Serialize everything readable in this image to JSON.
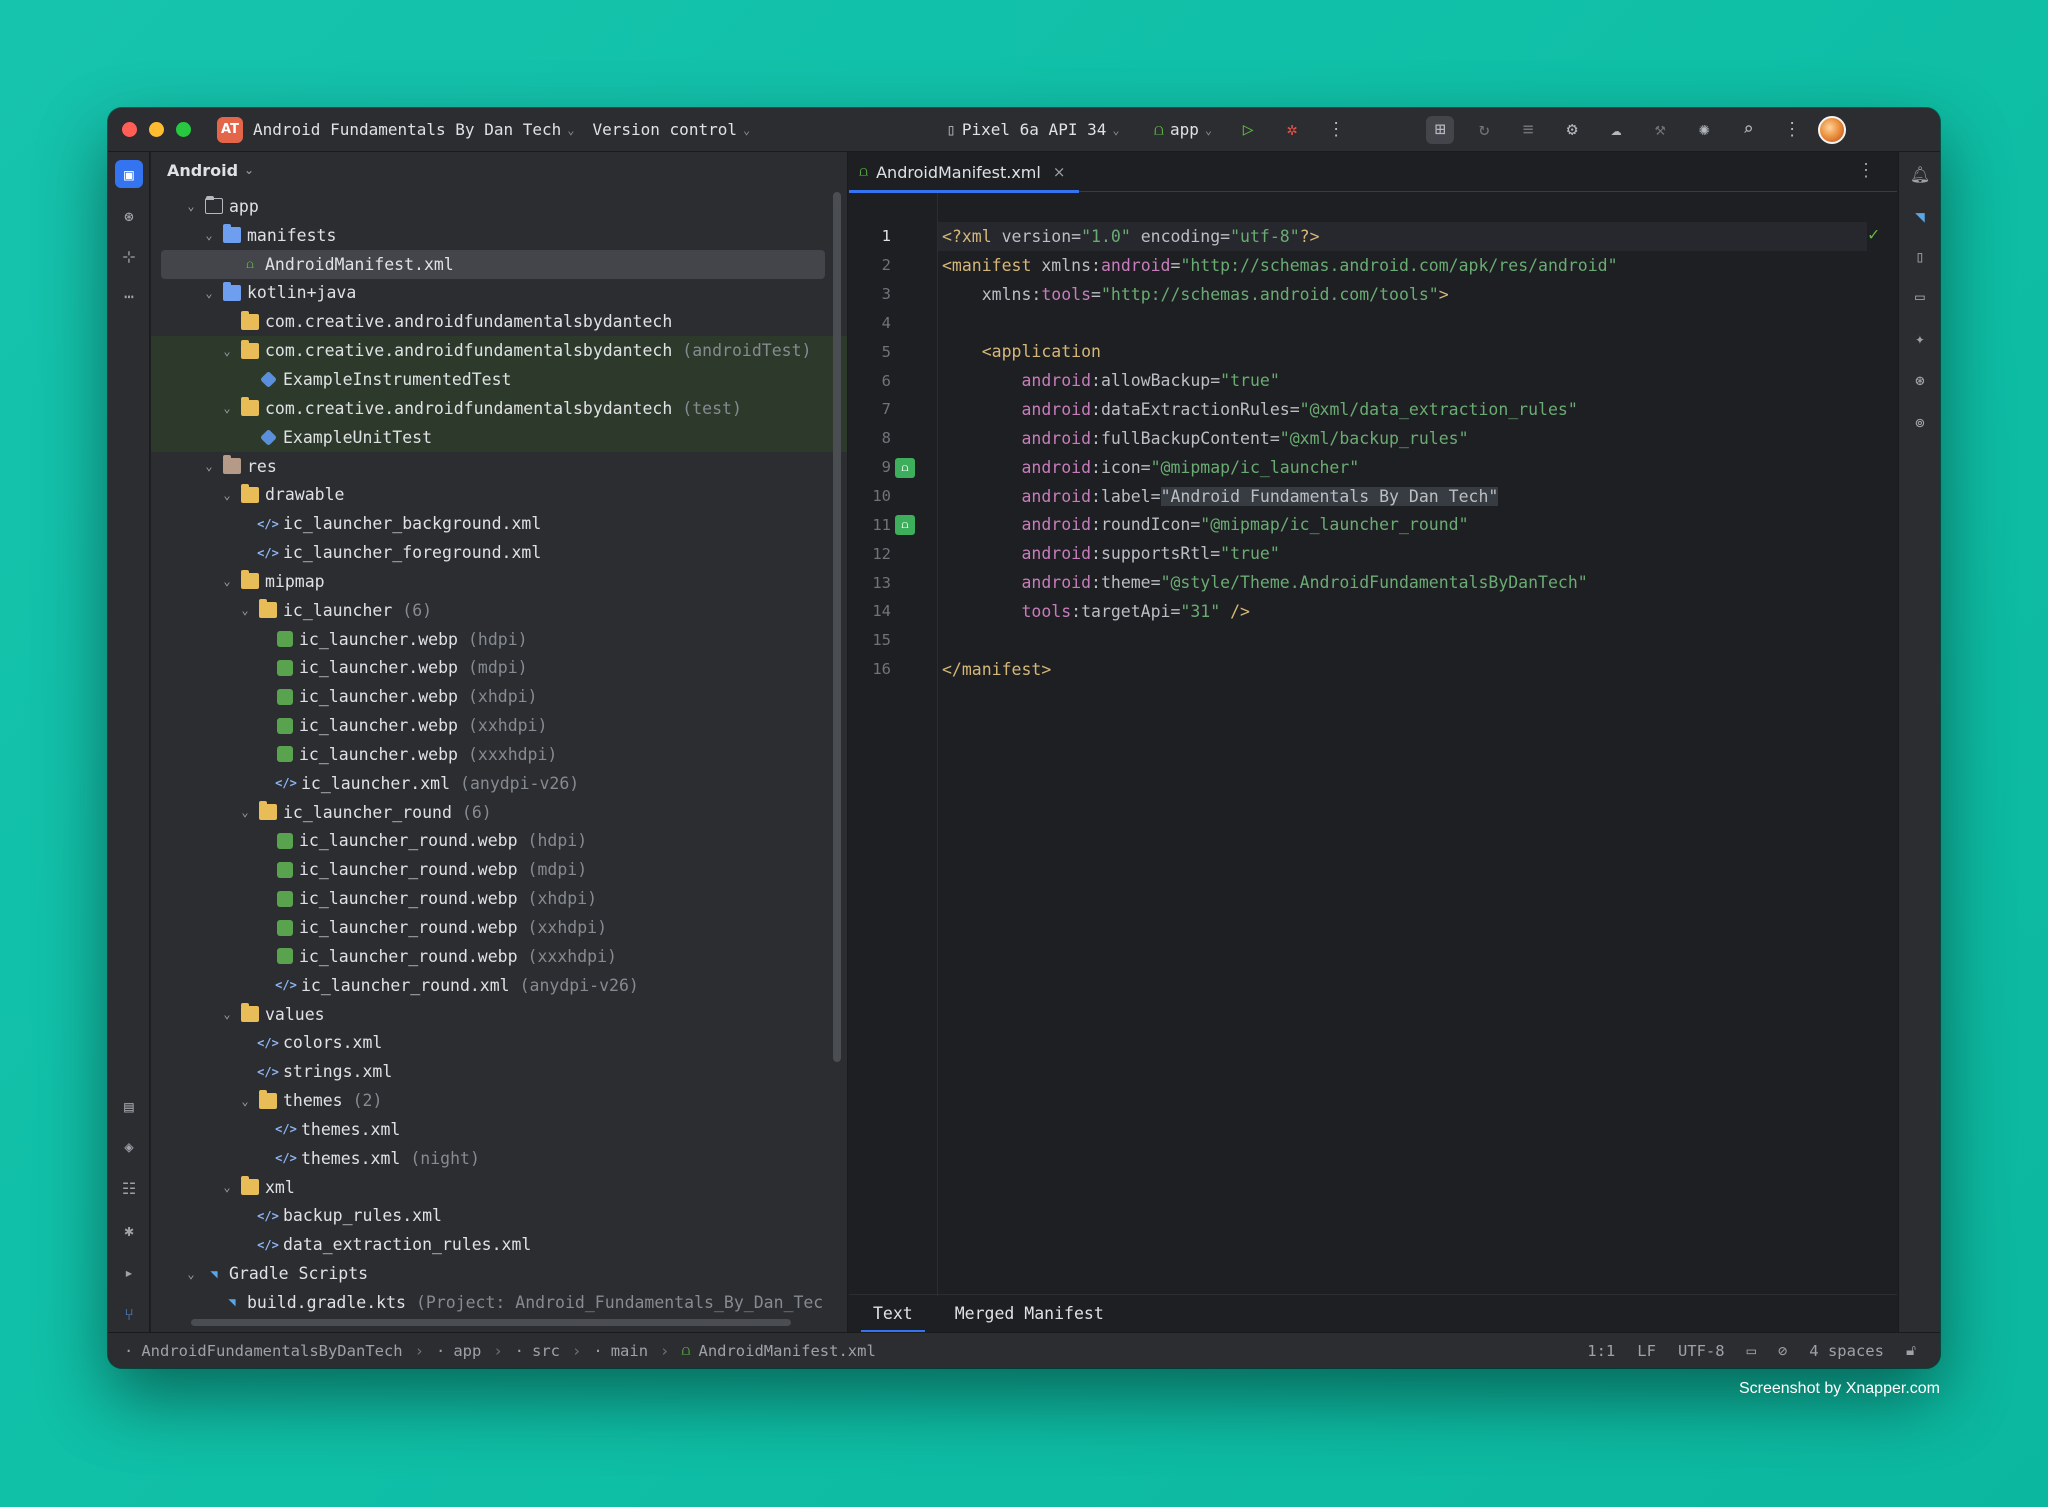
{
  "titlebar": {
    "project_initials": "AT",
    "project_name": "Android Fundamentals By Dan Tech",
    "vcs_label": "Version control",
    "device": "Pixel 6a API 34",
    "run_config": "app"
  },
  "project_panel": {
    "view_label": "Android",
    "tree": [
      {
        "depth": 0,
        "arrow": "v",
        "icon": "folder-outline",
        "label": "app"
      },
      {
        "depth": 1,
        "arrow": "v",
        "icon": "folder-blue",
        "label": "manifests"
      },
      {
        "depth": 2,
        "arrow": "",
        "icon": "android",
        "label": "AndroidManifest.xml",
        "selected": true
      },
      {
        "depth": 1,
        "arrow": "v",
        "icon": "folder-blue",
        "label": "kotlin+java"
      },
      {
        "depth": 2,
        "arrow": "",
        "icon": "folder",
        "label": "com.creative.androidfundamentalsbydantech"
      },
      {
        "depth": 2,
        "arrow": "v",
        "icon": "folder",
        "label": "com.creative.androidfundamentalsbydantech",
        "suffix": "(androidTest)",
        "test": true
      },
      {
        "depth": 3,
        "arrow": "",
        "icon": "class",
        "label": "ExampleInstrumentedTest",
        "test": true
      },
      {
        "depth": 2,
        "arrow": "v",
        "icon": "folder",
        "label": "com.creative.androidfundamentalsbydantech",
        "suffix": "(test)",
        "test": true
      },
      {
        "depth": 3,
        "arrow": "",
        "icon": "class",
        "label": "ExampleUnitTest",
        "test": true
      },
      {
        "depth": 1,
        "arrow": "v",
        "icon": "folder-res",
        "label": "res"
      },
      {
        "depth": 2,
        "arrow": "v",
        "icon": "folder",
        "label": "drawable"
      },
      {
        "depth": 3,
        "arrow": "",
        "icon": "xml",
        "label": "ic_launcher_background.xml"
      },
      {
        "depth": 3,
        "arrow": "",
        "icon": "xml",
        "label": "ic_launcher_foreground.xml"
      },
      {
        "depth": 2,
        "arrow": "v",
        "icon": "folder",
        "label": "mipmap"
      },
      {
        "depth": 3,
        "arrow": "v",
        "icon": "folder",
        "label": "ic_launcher",
        "suffix": "(6)"
      },
      {
        "depth": 4,
        "arrow": "",
        "icon": "webp",
        "label": "ic_launcher.webp",
        "suffix": "(hdpi)"
      },
      {
        "depth": 4,
        "arrow": "",
        "icon": "webp",
        "label": "ic_launcher.webp",
        "suffix": "(mdpi)"
      },
      {
        "depth": 4,
        "arrow": "",
        "icon": "webp",
        "label": "ic_launcher.webp",
        "suffix": "(xhdpi)"
      },
      {
        "depth": 4,
        "arrow": "",
        "icon": "webp",
        "label": "ic_launcher.webp",
        "suffix": "(xxhdpi)"
      },
      {
        "depth": 4,
        "arrow": "",
        "icon": "webp",
        "label": "ic_launcher.webp",
        "suffix": "(xxxhdpi)"
      },
      {
        "depth": 4,
        "arrow": "",
        "icon": "xml",
        "label": "ic_launcher.xml",
        "suffix": "(anydpi-v26)"
      },
      {
        "depth": 3,
        "arrow": "v",
        "icon": "folder",
        "label": "ic_launcher_round",
        "suffix": "(6)"
      },
      {
        "depth": 4,
        "arrow": "",
        "icon": "webp",
        "label": "ic_launcher_round.webp",
        "suffix": "(hdpi)"
      },
      {
        "depth": 4,
        "arrow": "",
        "icon": "webp",
        "label": "ic_launcher_round.webp",
        "suffix": "(mdpi)"
      },
      {
        "depth": 4,
        "arrow": "",
        "icon": "webp",
        "label": "ic_launcher_round.webp",
        "suffix": "(xhdpi)"
      },
      {
        "depth": 4,
        "arrow": "",
        "icon": "webp",
        "label": "ic_launcher_round.webp",
        "suffix": "(xxhdpi)"
      },
      {
        "depth": 4,
        "arrow": "",
        "icon": "webp",
        "label": "ic_launcher_round.webp",
        "suffix": "(xxxhdpi)"
      },
      {
        "depth": 4,
        "arrow": "",
        "icon": "xml",
        "label": "ic_launcher_round.xml",
        "suffix": "(anydpi-v26)"
      },
      {
        "depth": 2,
        "arrow": "v",
        "icon": "folder",
        "label": "values"
      },
      {
        "depth": 3,
        "arrow": "",
        "icon": "xml",
        "label": "colors.xml"
      },
      {
        "depth": 3,
        "arrow": "",
        "icon": "xml",
        "label": "strings.xml"
      },
      {
        "depth": 3,
        "arrow": "v",
        "icon": "folder",
        "label": "themes",
        "suffix": "(2)"
      },
      {
        "depth": 4,
        "arrow": "",
        "icon": "xml",
        "label": "themes.xml"
      },
      {
        "depth": 4,
        "arrow": "",
        "icon": "xml",
        "label": "themes.xml",
        "suffix": "(night)"
      },
      {
        "depth": 2,
        "arrow": "v",
        "icon": "folder",
        "label": "xml"
      },
      {
        "depth": 3,
        "arrow": "",
        "icon": "xml",
        "label": "backup_rules.xml"
      },
      {
        "depth": 3,
        "arrow": "",
        "icon": "xml",
        "label": "data_extraction_rules.xml"
      },
      {
        "depth": 0,
        "arrow": "v",
        "icon": "gradle",
        "label": "Gradle Scripts"
      },
      {
        "depth": 1,
        "arrow": "",
        "icon": "gradle",
        "label": "build.gradle.kts",
        "suffix": "(Project: Android_Fundamentals_By_Dan_Tec"
      }
    ]
  },
  "editor": {
    "tab_label": "AndroidManifest.xml",
    "line_numbers": [
      "1",
      "2",
      "3",
      "4",
      "5",
      "6",
      "7",
      "8",
      "9",
      "10",
      "11",
      "12",
      "13",
      "14",
      "15",
      "16"
    ],
    "gutter_icons_on_lines": [
      "9",
      "11"
    ],
    "current_line": "1",
    "code_lines": [
      [
        [
          "tg",
          "<?xml "
        ],
        [
          "at",
          "version="
        ],
        [
          "st",
          "\"1.0\""
        ],
        [
          "at",
          " encoding="
        ],
        [
          "st",
          "\"utf-8\""
        ],
        [
          "tg",
          "?>"
        ]
      ],
      [
        [
          "tg",
          "<manifest "
        ],
        [
          "at",
          "xmlns:"
        ],
        [
          "ns",
          "android"
        ],
        [
          "at",
          "="
        ],
        [
          "st",
          "\"http://schemas.android.com/apk/res/android\""
        ]
      ],
      [
        [
          "at",
          "    xmlns:"
        ],
        [
          "ns",
          "tools"
        ],
        [
          "at",
          "="
        ],
        [
          "st",
          "\"http://schemas.android.com/tools\""
        ],
        [
          "tg",
          ">"
        ]
      ],
      [],
      [
        [
          "tg",
          "    <application"
        ]
      ],
      [
        [
          "ns",
          "        android"
        ],
        [
          "at",
          ":allowBackup="
        ],
        [
          "st",
          "\"true\""
        ]
      ],
      [
        [
          "ns",
          "        android"
        ],
        [
          "at",
          ":dataExtractionRules="
        ],
        [
          "st",
          "\"@xml/data_extraction_rules\""
        ]
      ],
      [
        [
          "ns",
          "        android"
        ],
        [
          "at",
          ":fullBackupContent="
        ],
        [
          "st",
          "\"@xml/backup_rules\""
        ]
      ],
      [
        [
          "ns",
          "        android"
        ],
        [
          "at",
          ":icon="
        ],
        [
          "st",
          "\"@mipmap/ic_launcher\""
        ]
      ],
      [
        [
          "ns",
          "        android"
        ],
        [
          "at",
          ":label="
        ],
        [
          "hl",
          "\"Android Fundamentals By Dan Tech\""
        ]
      ],
      [
        [
          "ns",
          "        android"
        ],
        [
          "at",
          ":roundIcon="
        ],
        [
          "st",
          "\"@mipmap/ic_launcher_round\""
        ]
      ],
      [
        [
          "ns",
          "        android"
        ],
        [
          "at",
          ":supportsRtl="
        ],
        [
          "st",
          "\"true\""
        ]
      ],
      [
        [
          "ns",
          "        android"
        ],
        [
          "at",
          ":theme="
        ],
        [
          "st",
          "\"@style/Theme.AndroidFundamentalsByDanTech\""
        ]
      ],
      [
        [
          "ns",
          "        tools"
        ],
        [
          "at",
          ":targetApi="
        ],
        [
          "st",
          "\"31\""
        ],
        [
          "tg",
          " />"
        ]
      ],
      [],
      [
        [
          "tg",
          "</manifest>"
        ]
      ]
    ],
    "bottom_tabs": [
      "Text",
      "Merged Manifest"
    ],
    "active_bottom_tab": "Text"
  },
  "statusbar": {
    "breadcrumbs": [
      "AndroidFundamentalsByDanTech",
      "app",
      "src",
      "main",
      "AndroidManifest.xml"
    ],
    "position": "1:1",
    "line_ending": "LF",
    "encoding": "UTF-8",
    "indent": "4 spaces"
  },
  "credit": "Screenshot by Xnapper.com",
  "colors": {
    "background": "#16c3ad",
    "accent": "#3574f0",
    "tag": "#d5b778",
    "namespace": "#c77dbb",
    "string": "#6aab73"
  }
}
